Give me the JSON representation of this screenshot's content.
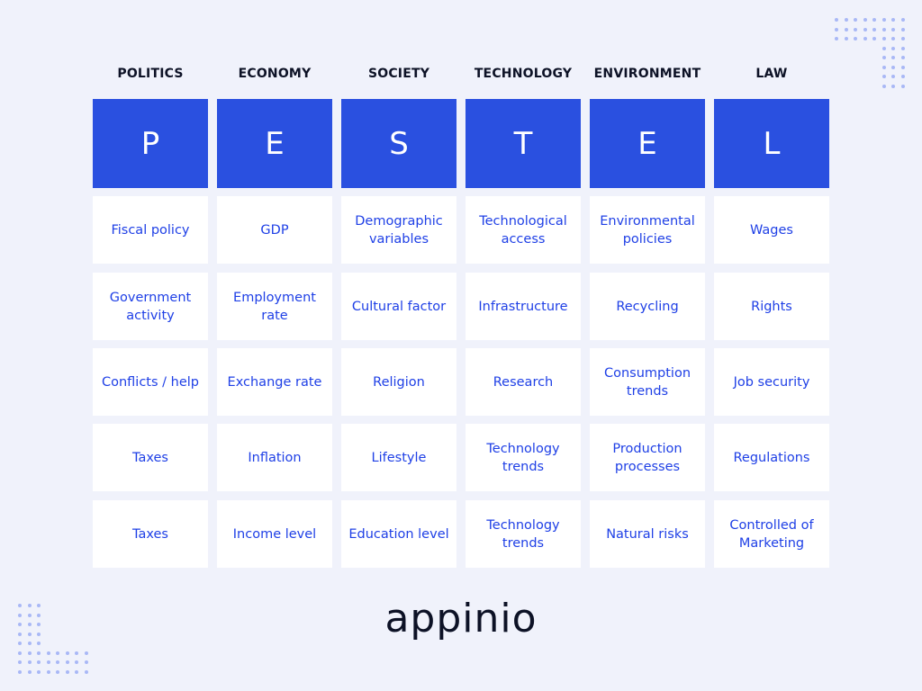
{
  "columns": [
    {
      "title": "POLITICS",
      "letter": "P",
      "items": [
        "Fiscal policy",
        "Government activity",
        "Conflicts / help",
        "Taxes",
        "Taxes"
      ]
    },
    {
      "title": "ECONOMY",
      "letter": "E",
      "items": [
        "GDP",
        "Employment rate",
        "Exchange rate",
        "Inflation",
        "Income level"
      ]
    },
    {
      "title": "SOCIETY",
      "letter": "S",
      "items": [
        "Demographic variables",
        "Cultural factor",
        "Religion",
        "Lifestyle",
        "Education level"
      ]
    },
    {
      "title": "TECHNOLOGY",
      "letter": "T",
      "items": [
        "Technological access",
        "Infrastructure",
        "Research",
        "Technology trends",
        "Technology trends"
      ]
    },
    {
      "title": "ENVIRONMENT",
      "letter": "E",
      "items": [
        "Environmental policies",
        "Recycling",
        "Consumption trends",
        "Production processes",
        "Natural risks"
      ]
    },
    {
      "title": "LAW",
      "letter": "L",
      "items": [
        "Wages",
        "Rights",
        "Job security",
        "Regulations",
        "Controlled of Marketing"
      ]
    }
  ],
  "logo": "appinio",
  "colors": {
    "accent": "#2a50e0",
    "cell_text": "#1f40e6",
    "heading": "#0d1226",
    "background": "#f0f2fb"
  }
}
